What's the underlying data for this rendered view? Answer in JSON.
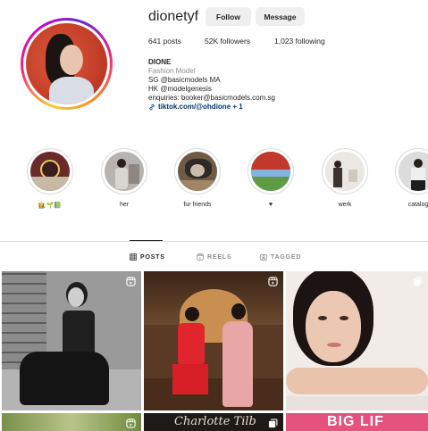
{
  "profile": {
    "username": "dionetyf",
    "follow_label": "Follow",
    "message_label": "Message",
    "stats": {
      "posts": "641 posts",
      "followers": "52K followers",
      "following": "1,023 following"
    },
    "bio": {
      "name": "DIONE",
      "category": "Fashion Model",
      "line1": "SG @basicmodels MA",
      "line2": "HK @modelgenesis",
      "line3": "enquiries: booker@basicmodels.com.sg",
      "link": "tiktok.com/@ohdione + 1"
    }
  },
  "highlights": [
    {
      "label": "👩‍🌾🌱📗",
      "icon": "highlight-1"
    },
    {
      "label": "her",
      "icon": "highlight-2"
    },
    {
      "label": "fur friends",
      "icon": "highlight-3"
    },
    {
      "label": "♥",
      "icon": "heart-icon"
    },
    {
      "label": "werk",
      "icon": "highlight-5"
    },
    {
      "label": "catalog",
      "icon": "highlight-6"
    }
  ],
  "tabs": [
    {
      "label": "POSTS",
      "icon": "grid-icon",
      "active": true
    },
    {
      "label": "REELS",
      "icon": "reels-icon",
      "active": false
    },
    {
      "label": "TAGGED",
      "icon": "tag-icon",
      "active": false
    }
  ],
  "posts": [
    {
      "icon": "reel-icon",
      "text": ""
    },
    {
      "icon": "reel-icon",
      "text": ""
    },
    {
      "icon": "carousel-icon",
      "text": ""
    },
    {
      "icon": "reel-icon",
      "text": ""
    },
    {
      "icon": "carousel-icon",
      "text": "Charlotte Tilb"
    },
    {
      "icon": "none",
      "text": "BIG LIF"
    }
  ]
}
